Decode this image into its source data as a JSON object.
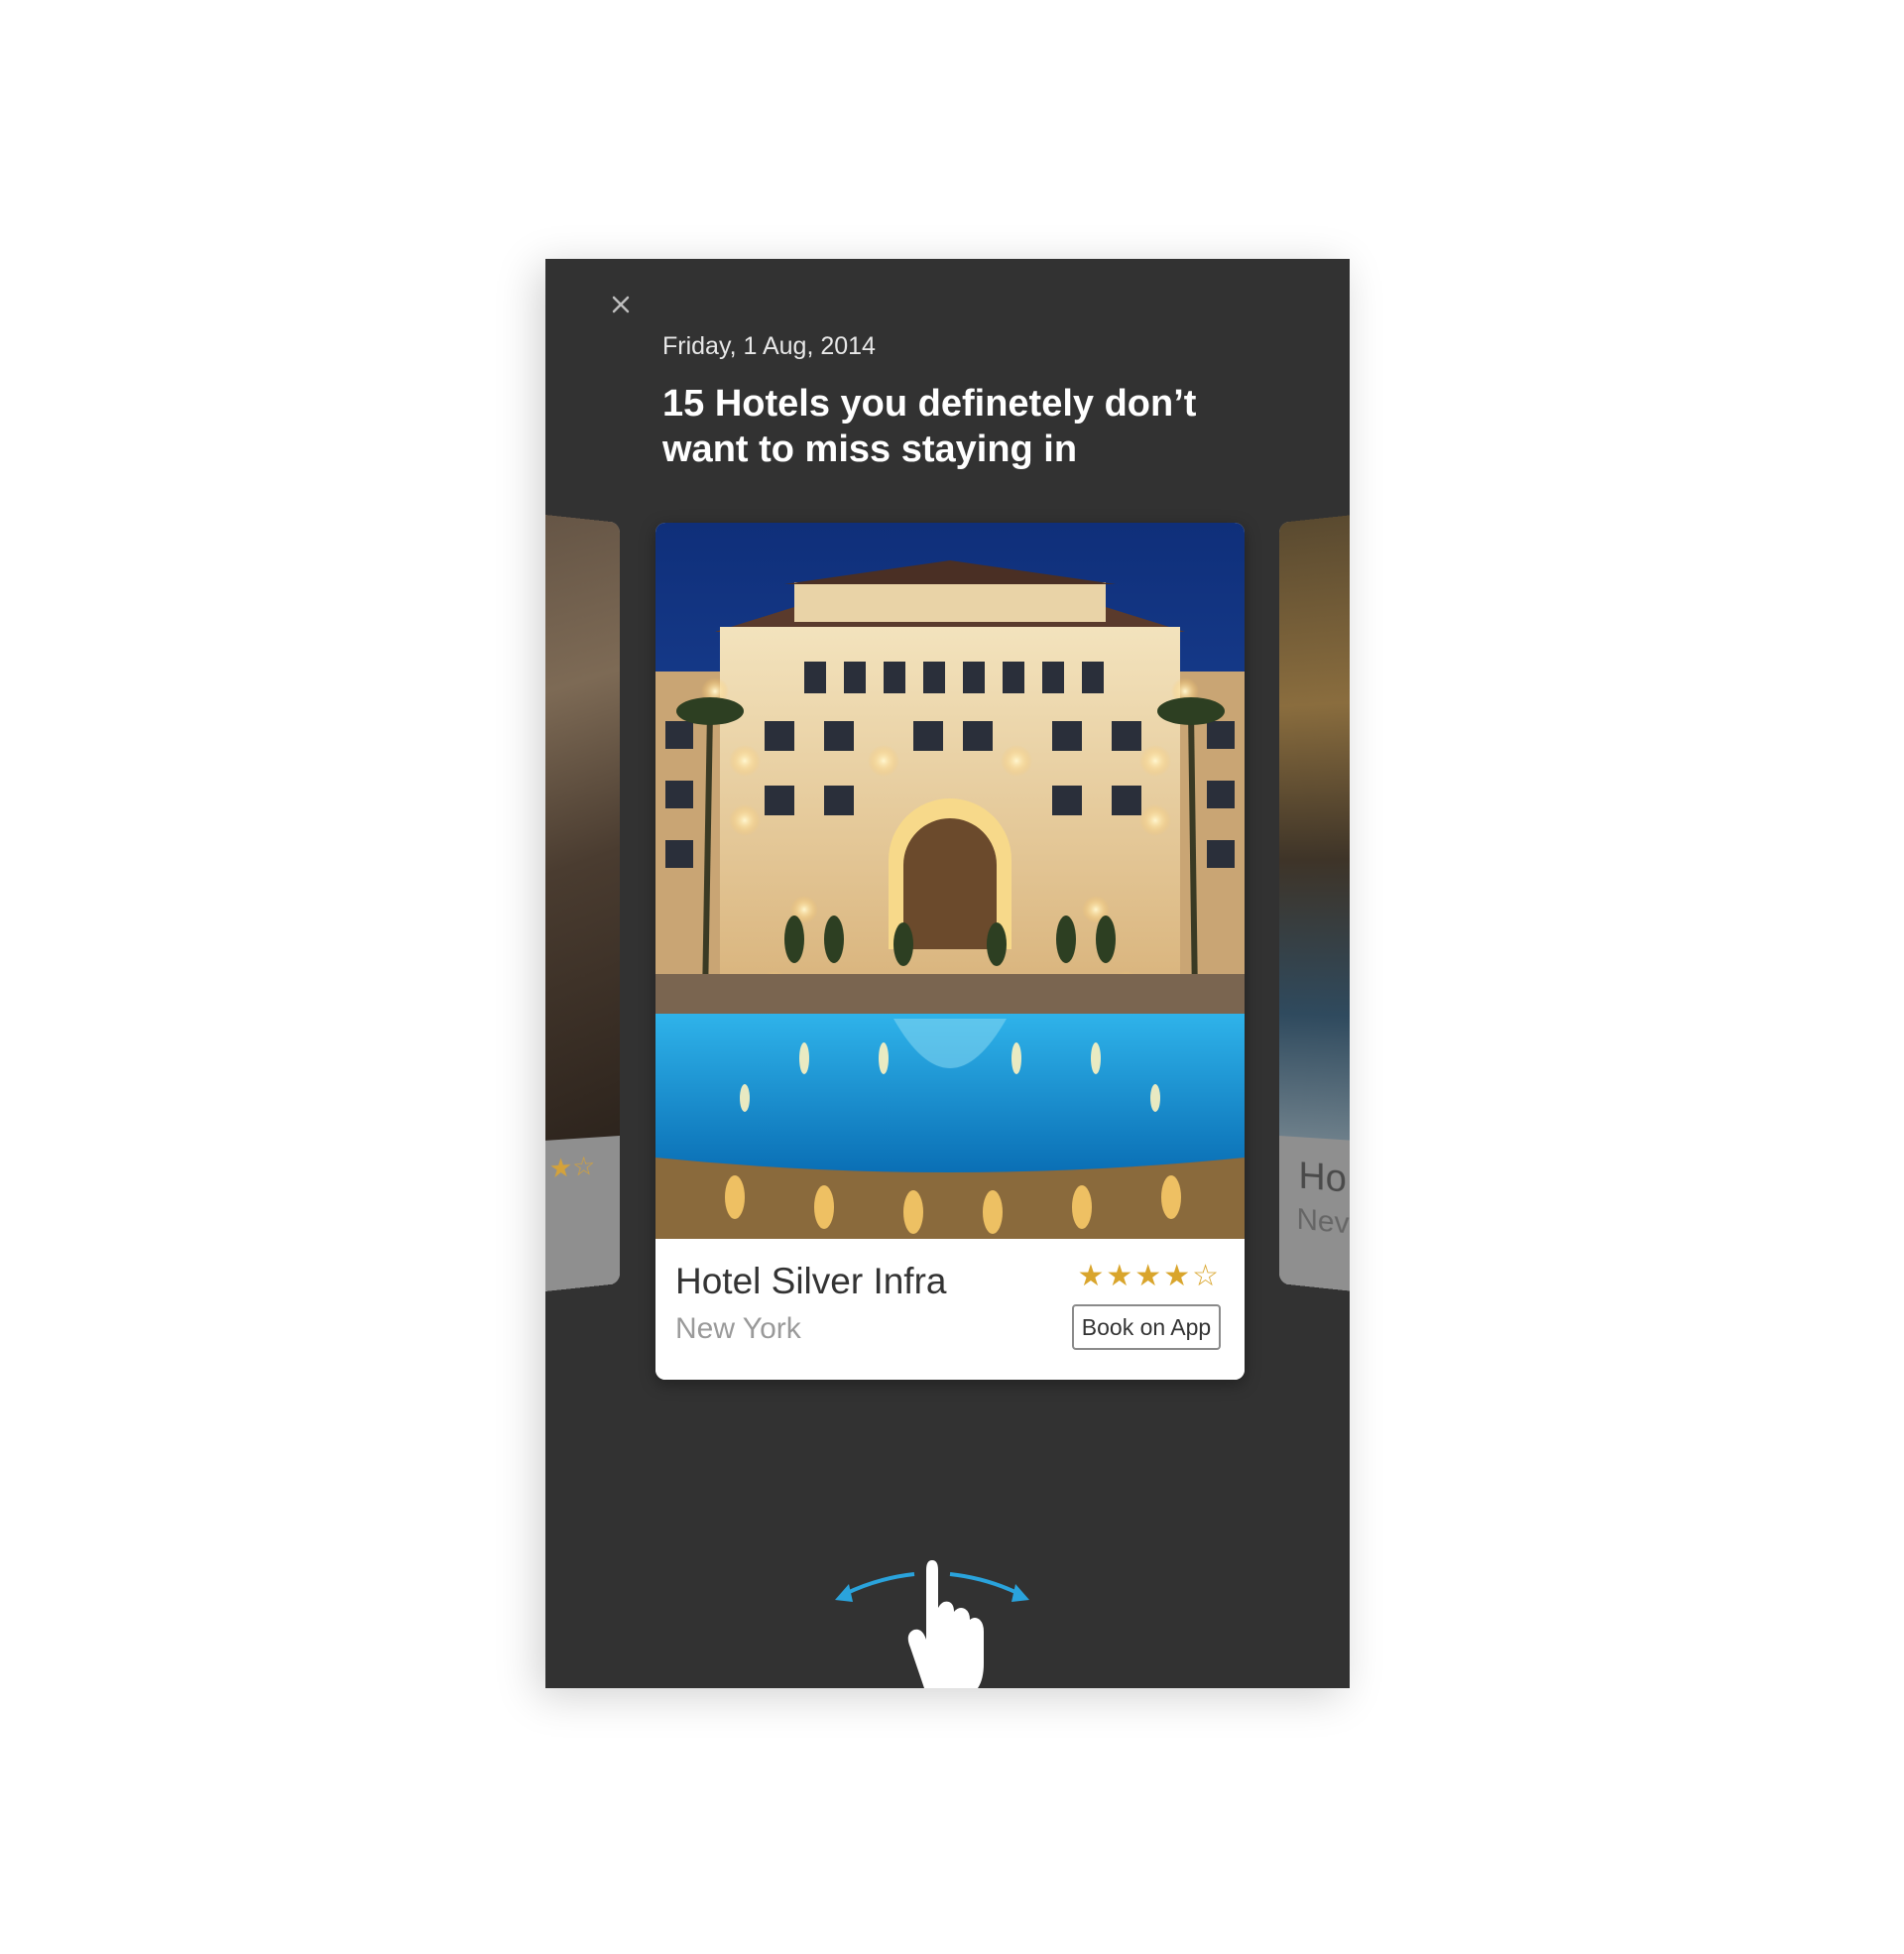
{
  "article": {
    "date": "Friday, 1 Aug, 2014",
    "headline": "15 Hotels you definetely don’t want to miss staying in"
  },
  "cards": {
    "current": {
      "name": "Hotel Silver Infra",
      "city": "New York",
      "rating": 4,
      "rating_max": 5,
      "stars_full": "★★★★",
      "stars_empty": "☆",
      "book_label": "Book on App"
    },
    "previous": {
      "stars": "★☆"
    },
    "next": {
      "name_partial": "Ho",
      "city_partial": "Nev"
    }
  },
  "icons": {
    "close": "close-icon",
    "swipe": "swipe-gesture-icon"
  },
  "colors": {
    "background": "#323232",
    "star": "#d9a52c",
    "swipe_arrows": "#2aa3dc"
  }
}
